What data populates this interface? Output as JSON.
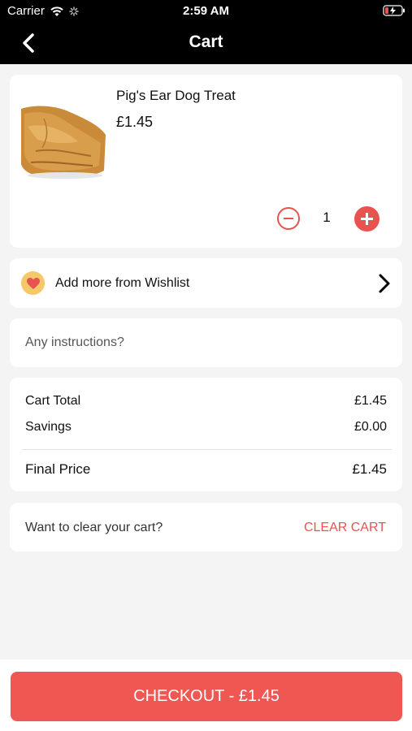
{
  "status_bar": {
    "carrier": "Carrier",
    "time": "2:59 AM"
  },
  "nav": {
    "title": "Cart",
    "back_icon": "chevron-left-icon"
  },
  "cart": {
    "items": [
      {
        "name": "Pig's Ear Dog Treat",
        "price": "£1.45",
        "quantity": "1",
        "image_icon": "pig-ear-treat-image"
      }
    ]
  },
  "wishlist": {
    "label": "Add more from Wishlist",
    "icon": "heart-icon"
  },
  "instructions": {
    "placeholder": "Any instructions?",
    "value": ""
  },
  "totals": {
    "cart_total_label": "Cart Total",
    "cart_total_value": "£1.45",
    "savings_label": "Savings",
    "savings_value": "£0.00",
    "final_price_label": "Final Price",
    "final_price_value": "£1.45"
  },
  "clear_cart": {
    "prompt": "Want to clear your cart?",
    "button": "CLEAR CART"
  },
  "checkout": {
    "label": "CHECKOUT - £1.45"
  },
  "colors": {
    "accent": "#ef5753",
    "nav_background": "#000000",
    "page_background": "#f4f4f4"
  }
}
